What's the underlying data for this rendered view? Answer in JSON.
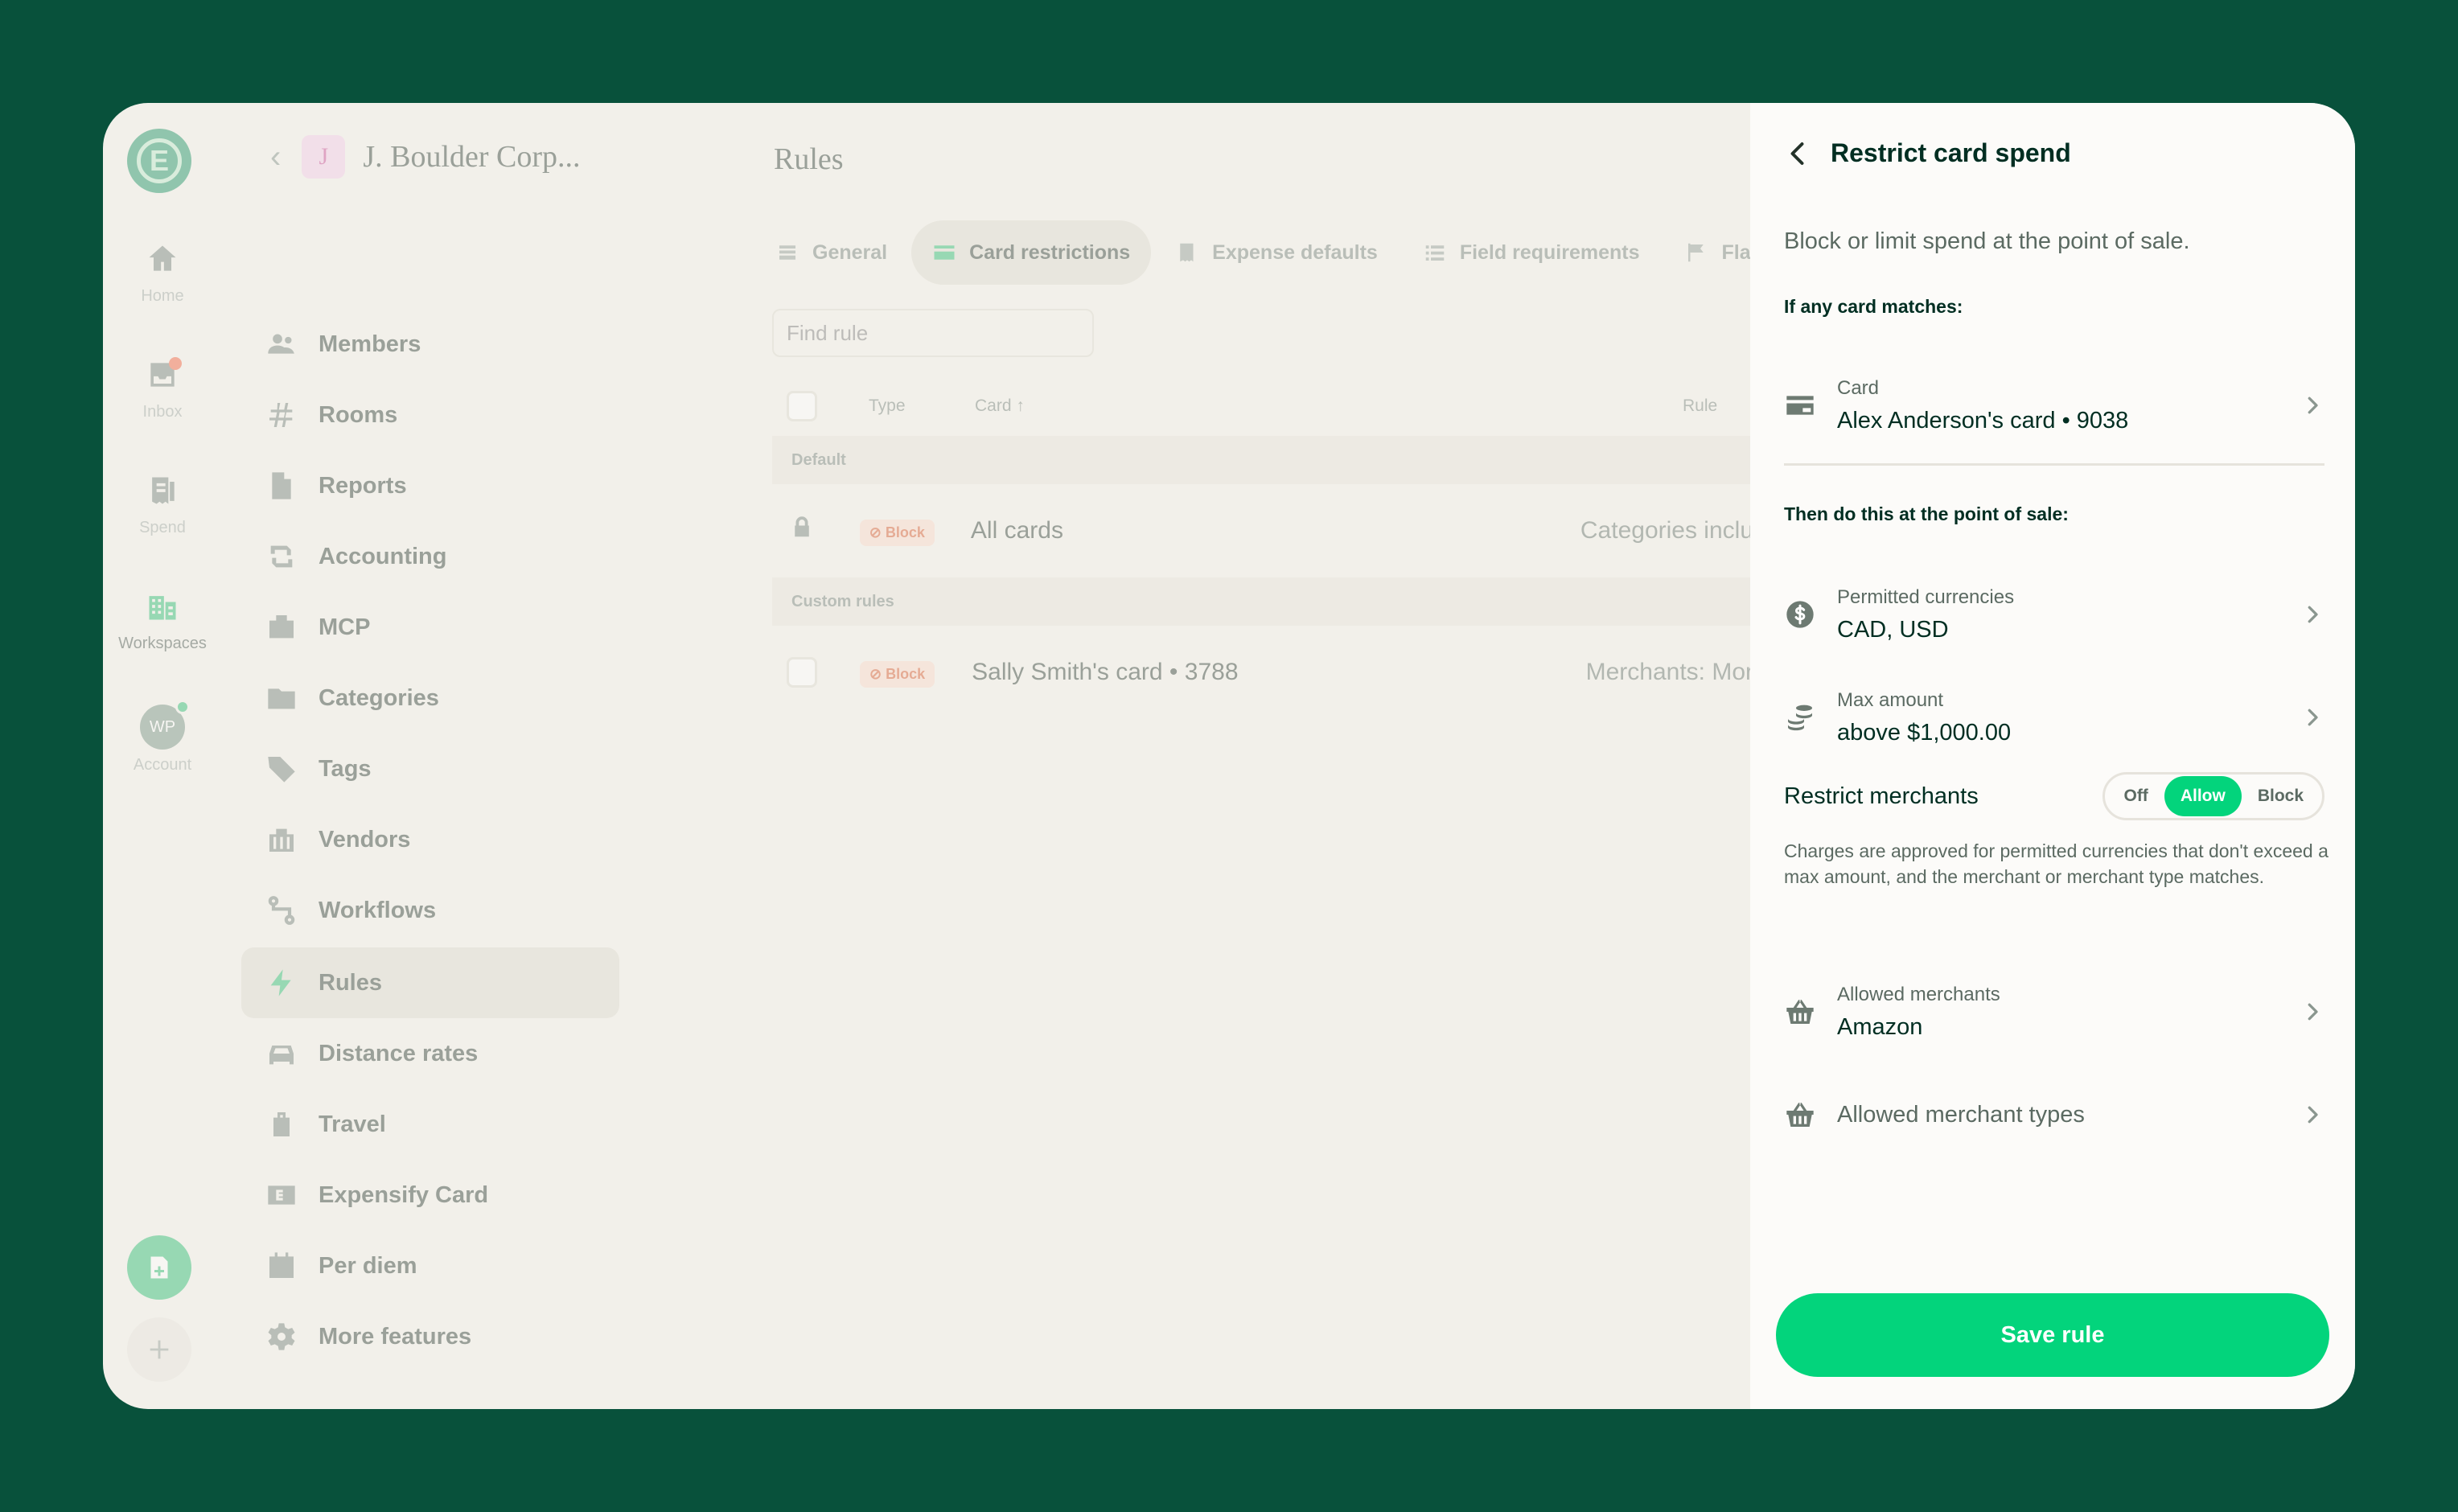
{
  "rail": {
    "items": [
      {
        "label": "Home",
        "icon": "home-icon"
      },
      {
        "label": "Inbox",
        "icon": "inbox-icon"
      },
      {
        "label": "Spend",
        "icon": "receipt-icon"
      },
      {
        "label": "Workspaces",
        "icon": "building-icon"
      },
      {
        "label": "Account",
        "icon": "avatar-icon"
      }
    ],
    "account_initials": "WP"
  },
  "workspace": {
    "initial": "J",
    "name": "J. Boulder Corp..."
  },
  "sidenav": {
    "items": [
      {
        "label": "Members",
        "icon": "users-icon"
      },
      {
        "label": "Rooms",
        "icon": "hash-icon"
      },
      {
        "label": "Reports",
        "icon": "document-icon"
      },
      {
        "label": "Accounting",
        "icon": "sync-icon"
      },
      {
        "label": "MCP",
        "icon": "mcp-icon"
      },
      {
        "label": "Categories",
        "icon": "folder-icon"
      },
      {
        "label": "Tags",
        "icon": "tag-icon"
      },
      {
        "label": "Vendors",
        "icon": "vendors-icon"
      },
      {
        "label": "Workflows",
        "icon": "workflow-icon"
      },
      {
        "label": "Rules",
        "icon": "bolt-icon"
      },
      {
        "label": "Distance rates",
        "icon": "car-icon"
      },
      {
        "label": "Travel",
        "icon": "luggage-icon"
      },
      {
        "label": "Expensify Card",
        "icon": "expensify-card-icon"
      },
      {
        "label": "Per diem",
        "icon": "calendar-icon"
      },
      {
        "label": "More features",
        "icon": "gear-icon"
      }
    ],
    "active": "Rules"
  },
  "main": {
    "title": "Rules",
    "tabs": [
      {
        "label": "General",
        "icon": "stack-icon"
      },
      {
        "label": "Card restrictions",
        "icon": "card-icon"
      },
      {
        "label": "Expense defaults",
        "icon": "receipt-icon"
      },
      {
        "label": "Field requirements",
        "icon": "list-icon"
      },
      {
        "label": "Flag for review",
        "icon": "flag-icon"
      }
    ],
    "active_tab": "Card restrictions",
    "search_placeholder": "Find rule",
    "columns": {
      "type": "Type",
      "card": "Card",
      "rule": "Rule"
    },
    "sections": {
      "default": "Default",
      "custom": "Custom rules"
    },
    "rows": [
      {
        "type": "Block",
        "card": "All cards",
        "rule": "Categories inclu"
      },
      {
        "type": "Block",
        "card": "Sally Smith's card • 3788",
        "rule": "Merchants: Mor"
      }
    ]
  },
  "panel": {
    "title": "Restrict card spend",
    "description": "Block or limit spend at the point of sale.",
    "if_heading": "If any card matches:",
    "card": {
      "label": "Card",
      "value": "Alex Anderson's card • 9038"
    },
    "then_heading": "Then do this at the point of sale:",
    "currencies": {
      "label": "Permitted currencies",
      "value": "CAD, USD"
    },
    "max_amount": {
      "label": "Max amount",
      "value": "above $1,000.00"
    },
    "restrict_merchants": {
      "label": "Restrict merchants",
      "options": [
        "Off",
        "Allow",
        "Block"
      ],
      "selected": "Allow"
    },
    "merchant_note": "Charges are approved for permitted currencies that don't exceed a max amount, and the merchant or merchant type matches.",
    "allowed_merchants": {
      "label": "Allowed merchants",
      "value": "Amazon"
    },
    "allowed_merchant_types": {
      "label": "Allowed merchant types"
    },
    "save_label": "Save rule"
  },
  "colors": {
    "brand_green": "#03d47c",
    "background": "#08513b",
    "dark_text": "#002e22",
    "block_badge": "#fbd6c6"
  }
}
